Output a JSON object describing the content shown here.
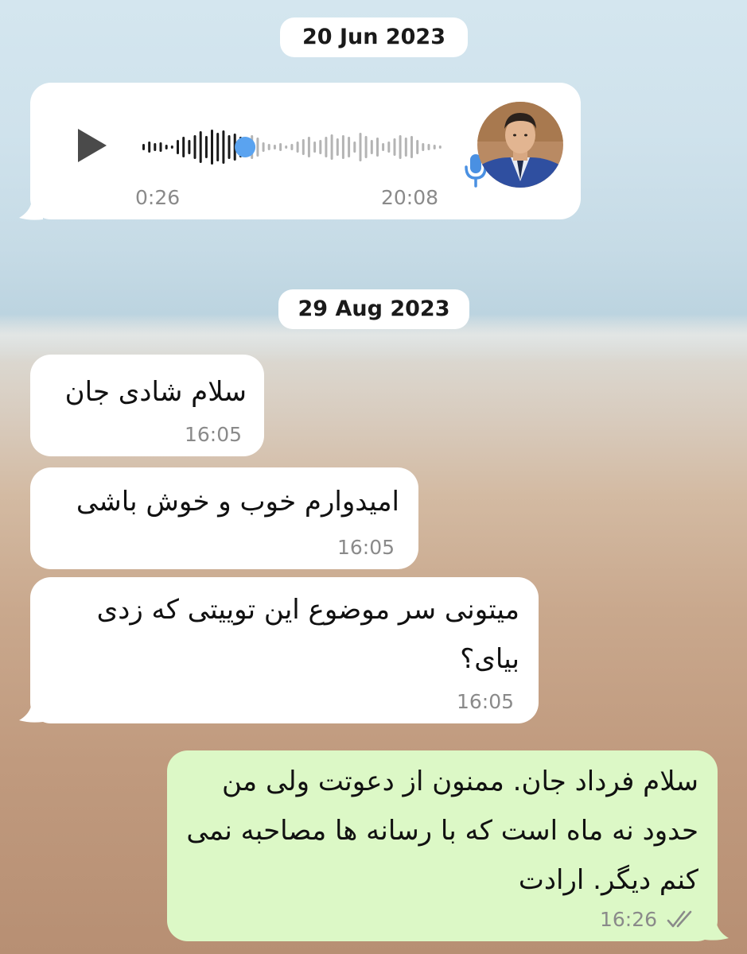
{
  "chat": {
    "date_1": "20 Jun 2023",
    "voice_message": {
      "duration": "0:26",
      "time": "20:08",
      "played_fraction": 0.34
    },
    "date_2": "29 Aug 2023",
    "messages": [
      {
        "text": "سلام شادی جان",
        "time": "16:05",
        "direction": "incoming"
      },
      {
        "text": "امیدوارم خوب و خوش باشی",
        "time": "16:05",
        "direction": "incoming"
      },
      {
        "text": "میتونی سر موضوع این توییتی که زدی بیای؟",
        "time": "16:05",
        "direction": "incoming"
      },
      {
        "text": "سلام فرداد جان. ممنون از دعوتت ولی من حدود نه ماه است که با رسانه ها مصاحبه نمی کنم دیگر. ارادت",
        "time": "16:26",
        "direction": "outgoing",
        "status": "read"
      }
    ]
  },
  "icons": {
    "play": "play-icon",
    "mic": "microphone-icon",
    "read": "double-check-icon"
  },
  "colors": {
    "incoming_bubble": "#ffffff",
    "outgoing_bubble": "#dcf8c6",
    "waveform_played": "#1a1a1a",
    "waveform_unplayed": "#b4b4b4",
    "progress_dot": "#5aa3f0",
    "mic_blue": "#4a90e2"
  }
}
